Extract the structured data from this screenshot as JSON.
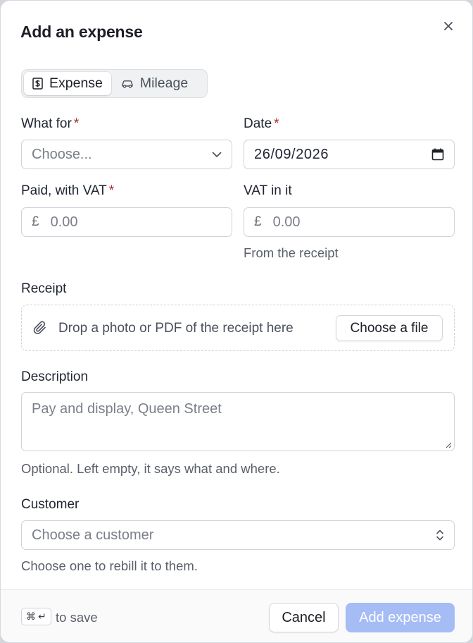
{
  "dialog": {
    "title": "Add an expense",
    "close_icon": "close-icon"
  },
  "tabs": [
    {
      "label": "Expense",
      "icon": "receipt-icon",
      "active": true
    },
    {
      "label": "Mileage",
      "icon": "car-icon",
      "active": false
    }
  ],
  "what_for": {
    "label": "What for",
    "required_mark": "*",
    "placeholder": "Choose..."
  },
  "date": {
    "label": "Date",
    "required_mark": "*",
    "value": "26/09/2026"
  },
  "paid": {
    "label": "Paid, with VAT",
    "required_mark": "*",
    "currency": "£",
    "placeholder": "0.00"
  },
  "vat": {
    "label": "VAT in it",
    "currency": "£",
    "placeholder": "0.00",
    "help": "From the receipt"
  },
  "receipt": {
    "label": "Receipt",
    "drop_text": "Drop a photo or PDF of the receipt here",
    "choose_label": "Choose a file"
  },
  "description": {
    "label": "Description",
    "placeholder": "Pay and display, Queen Street",
    "help": "Optional. Left empty, it says what and where."
  },
  "customer": {
    "label": "Customer",
    "placeholder": "Choose a customer",
    "help": "Choose one to rebill it to them."
  },
  "footer": {
    "shortcut_cmd": "⌘",
    "shortcut_enter": "↵",
    "save_hint": "to save",
    "cancel_label": "Cancel",
    "submit_label": "Add expense"
  },
  "colors": {
    "required": "#b0282f",
    "primary_disabled": "#a5bcf5"
  }
}
